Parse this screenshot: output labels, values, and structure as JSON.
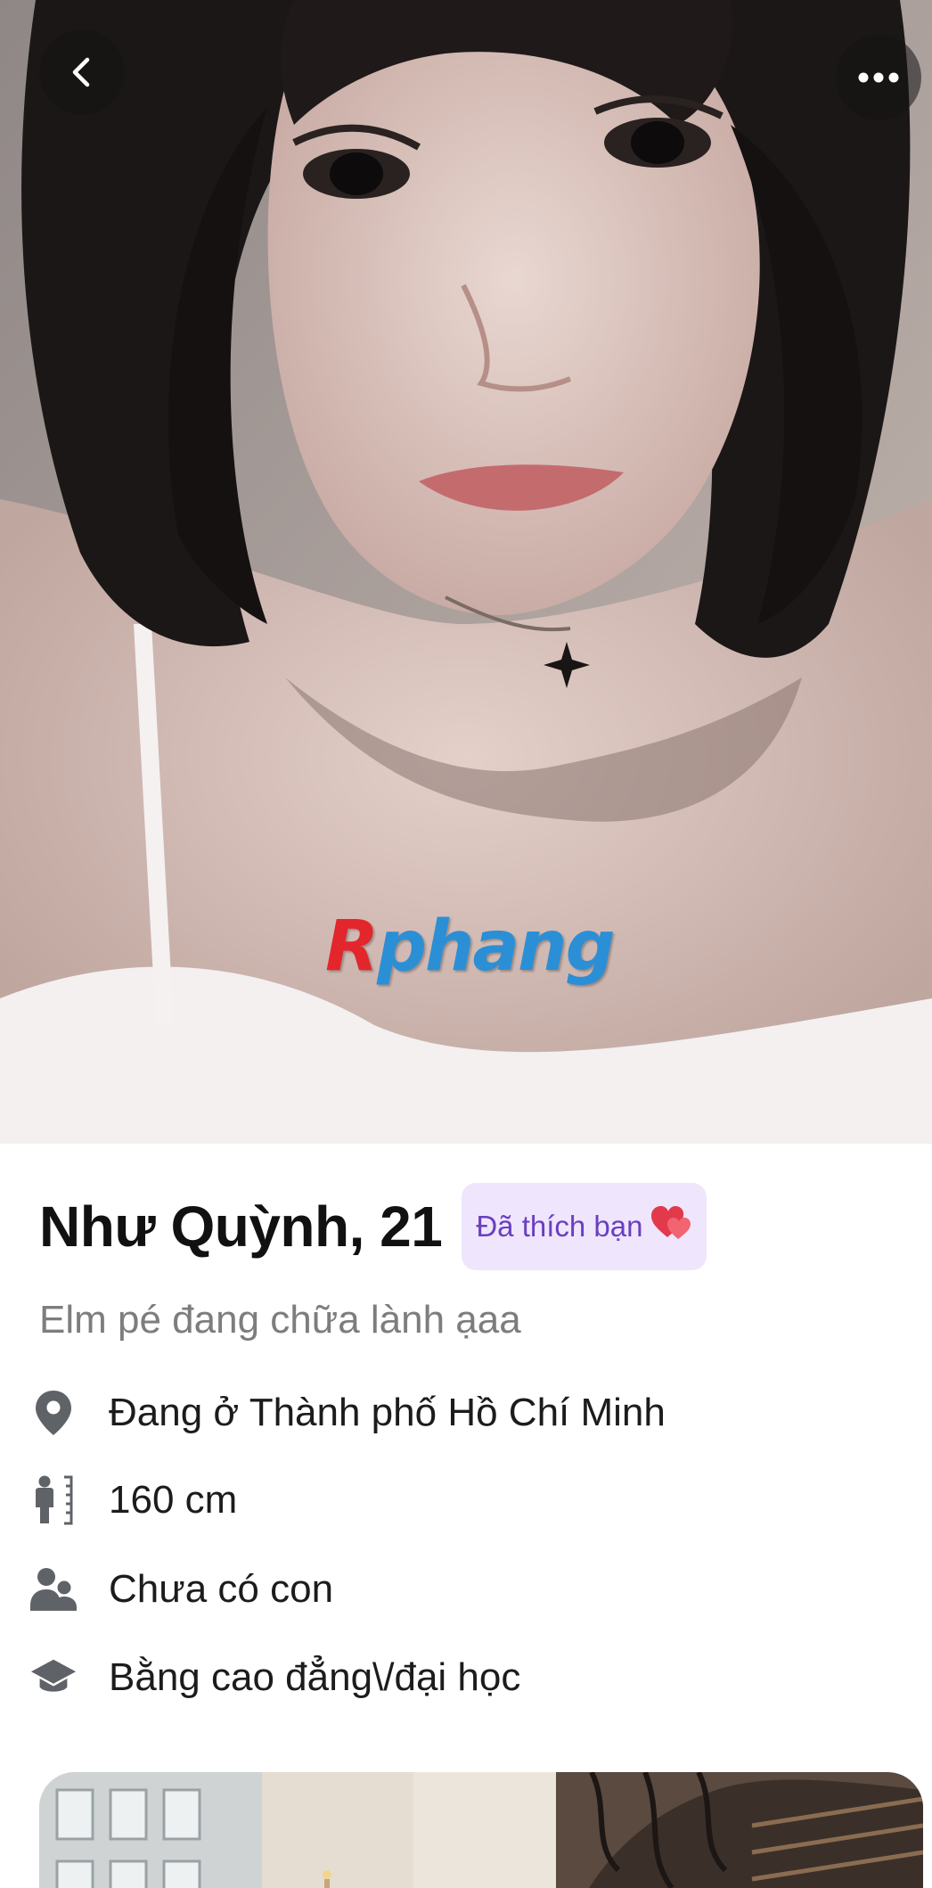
{
  "header": {
    "back_icon": "chevron-left-icon",
    "more_icon": "more-horizontal-icon"
  },
  "photo": {
    "watermark": {
      "first_letter": "R",
      "rest": "phang"
    }
  },
  "profile": {
    "name_age": "Như Quỳnh, 21",
    "liked_badge": "Đã thích bạn",
    "liked_badge_icon": "heart-icon",
    "bio": "Elm pé đang chữa lành ạaa",
    "details": [
      {
        "icon": "location-pin-icon",
        "label": "Đang ở Thành phố Hồ Chí Minh"
      },
      {
        "icon": "height-icon",
        "label": "160 cm"
      },
      {
        "icon": "children-icon",
        "label": "Chưa có con"
      },
      {
        "icon": "education-cap-icon",
        "label": "Bằng cao đẳng\\/đại học"
      }
    ]
  },
  "colors": {
    "badge_bg": "#efe6fd",
    "badge_text": "#6a3fc0",
    "icon_gray": "#5f6368"
  }
}
